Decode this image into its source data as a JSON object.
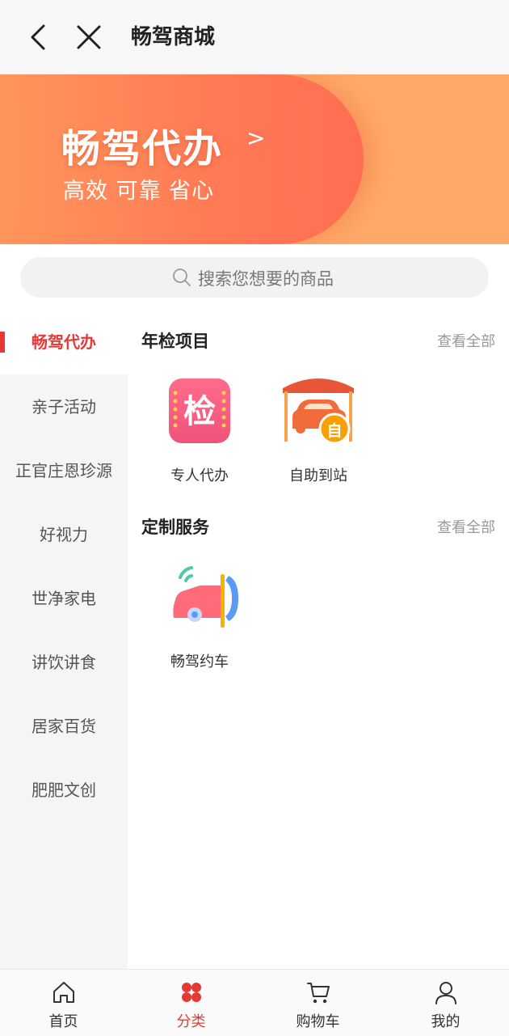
{
  "header": {
    "title": "畅驾商城",
    "back_icon": "back-arrow-icon",
    "close_icon": "close-icon"
  },
  "banner": {
    "title": "畅驾代办",
    "arrow": ">",
    "subtitle": "高效 可靠 省心"
  },
  "search": {
    "placeholder": "搜索您想要的商品"
  },
  "sidebar": {
    "items": [
      {
        "label": "畅驾代办",
        "active": true
      },
      {
        "label": "亲子活动"
      },
      {
        "label": "正官庄恩珍源"
      },
      {
        "label": "好视力"
      },
      {
        "label": "世净家电"
      },
      {
        "label": "讲饮讲食"
      },
      {
        "label": "居家百货"
      },
      {
        "label": "肥肥文创"
      }
    ]
  },
  "sections": [
    {
      "title": "年检项目",
      "view_all": "查看全部",
      "items": [
        {
          "label": "专人代办",
          "icon": "inspection-badge-icon",
          "icon_text": "检"
        },
        {
          "label": "自助到站",
          "icon": "car-station-icon",
          "icon_text": "自"
        }
      ]
    },
    {
      "title": "定制服务",
      "view_all": "查看全部",
      "items": [
        {
          "label": "畅驾约车",
          "icon": "car-call-icon"
        }
      ]
    }
  ],
  "tabbar": {
    "tabs": [
      {
        "label": "首页",
        "icon": "home-icon"
      },
      {
        "label": "分类",
        "icon": "category-icon",
        "active": true
      },
      {
        "label": "购物车",
        "icon": "cart-icon"
      },
      {
        "label": "我的",
        "icon": "user-icon"
      }
    ]
  },
  "colors": {
    "accent": "#e53935",
    "banner_bg": "#ffa968",
    "banner_blob": "#ff7b55",
    "sidebar_bg": "#f4f5f7"
  }
}
